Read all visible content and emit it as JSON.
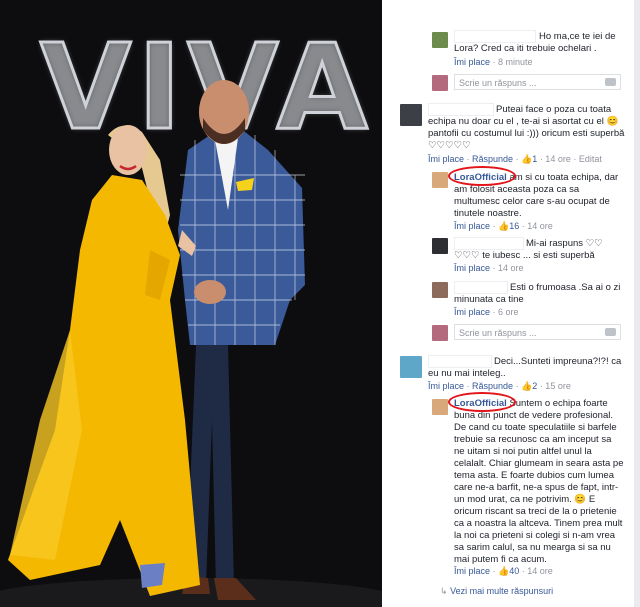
{
  "photo": {
    "sign_text": "VIVA!"
  },
  "comments": [
    {
      "text": "Ho ma,ce te iei de Lora? Cred ca iti trebuie ochelari .",
      "like": "Îmi place",
      "time": "· 8 minute"
    },
    {
      "reply_placeholder": "Scrie un răspuns ..."
    },
    {
      "text": "Puteai face o poza cu toata echipa nu doar cu el , te-ai si asortat cu el 😊 pantofii cu costumul lui :))) oricum esti superbă ♡♡♡♡♡",
      "like": "Îmi place",
      "reply": "Răspunde",
      "likes_count": "1",
      "time": "· 14 ore",
      "edited": "· Editat"
    },
    {
      "author": "LoraOfficial",
      "text": "am si cu toata echipa, dar am folosit aceasta poza ca sa multumesc celor care s-au ocupat de tinutele noastre.",
      "like": "Îmi place",
      "likes_count": "16",
      "time": "· 14 ore"
    },
    {
      "text": "Mi-ai raspuns ♡♡ ♡♡♡ te iubesc ... si esti superbă",
      "like": "Îmi place",
      "time": "· 14 ore"
    },
    {
      "text": "Esti o frumoasa .Sa ai o zi minunata ca tine",
      "like": "Îmi place",
      "time": "· 6 ore"
    },
    {
      "reply_placeholder": "Scrie un răspuns ..."
    },
    {
      "text": "Deci...Sunteti impreuna?!?! ca eu nu mai inteleg..",
      "like": "Îmi place",
      "reply": "Răspunde",
      "likes_count": "2",
      "time": "· 15 ore"
    },
    {
      "author": "LoraOfficial",
      "text": "Suntem o echipa foarte buna din punct de vedere profesional. De cand cu toate speculatiile si barfele trebuie sa recunosc ca am inceput sa ne uitam si noi putin altfel unul la celalalt. Chiar glumeam in seara asta pe tema asta. E foarte dubios cum lumea care ne-a barfit, ne-a spus de fapt, intr-un mod urat, ca ne potrivim. 😊 E oricum riscant sa treci de la o prietenie ca a noastra la altceva. Tinem prea mult la noi ca prieteni si colegi si n-am vrea sa sarim calul, sa nu mearga si sa nu mai putem fi ca acum.",
      "like": "Îmi place",
      "likes_count": "40",
      "time": "· 14 ore"
    }
  ],
  "more_replies": "Vezi mai multe răspunsuri",
  "colors": {
    "link": "#365899",
    "highlight": "#e2151b",
    "dress": "#f5b800",
    "suit": "#2f4f8a"
  }
}
